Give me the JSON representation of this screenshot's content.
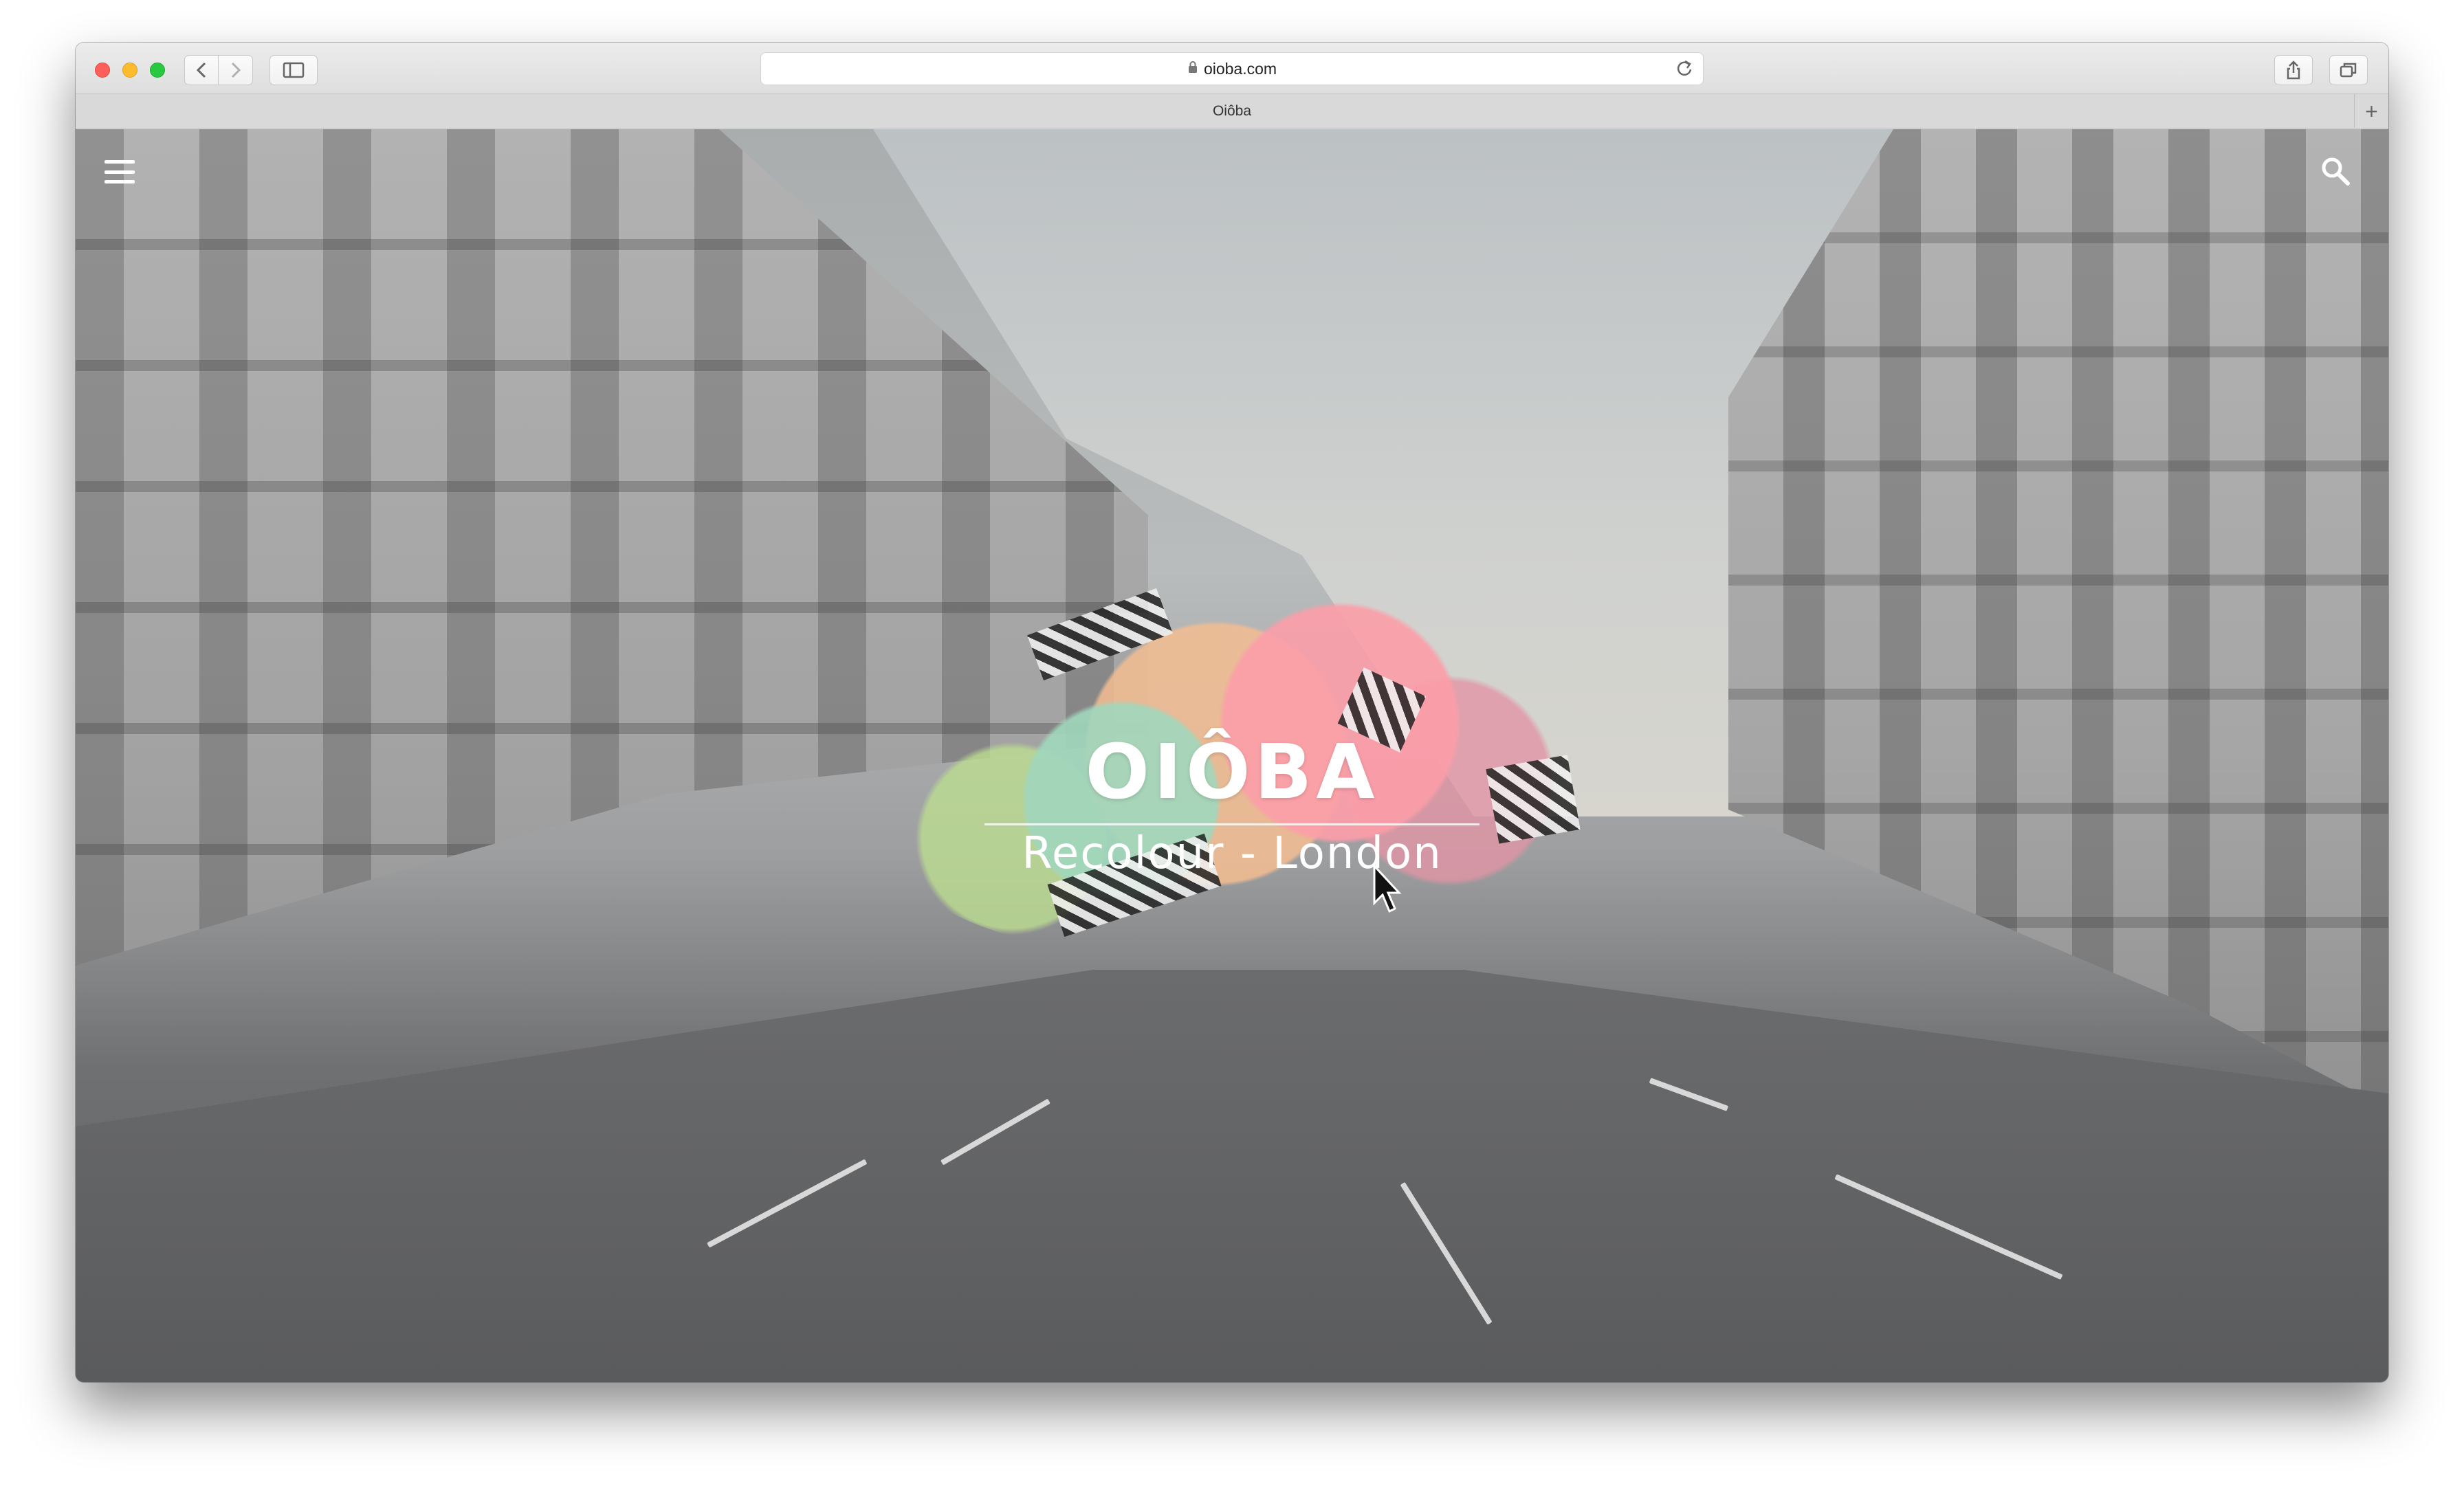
{
  "browser": {
    "url": "oioba.com",
    "tab_title": "Oiôba",
    "new_tab": "+"
  },
  "site": {
    "brand": "OIÔBA",
    "subtitle": "Recolour - London"
  },
  "icons": {
    "menu": "hamburger-menu-icon",
    "search": "search-icon",
    "back": "chevron-left-icon",
    "forward": "chevron-right-icon",
    "sidebar": "sidebar-icon",
    "share": "share-icon",
    "tabs": "tab-overview-icon",
    "reload": "reload-icon",
    "lock": "lock-icon"
  },
  "colors": {
    "close": "#fc5f57",
    "minimize": "#fdbc2e",
    "maximize": "#28c840",
    "overlay_text": "#ffffff"
  }
}
